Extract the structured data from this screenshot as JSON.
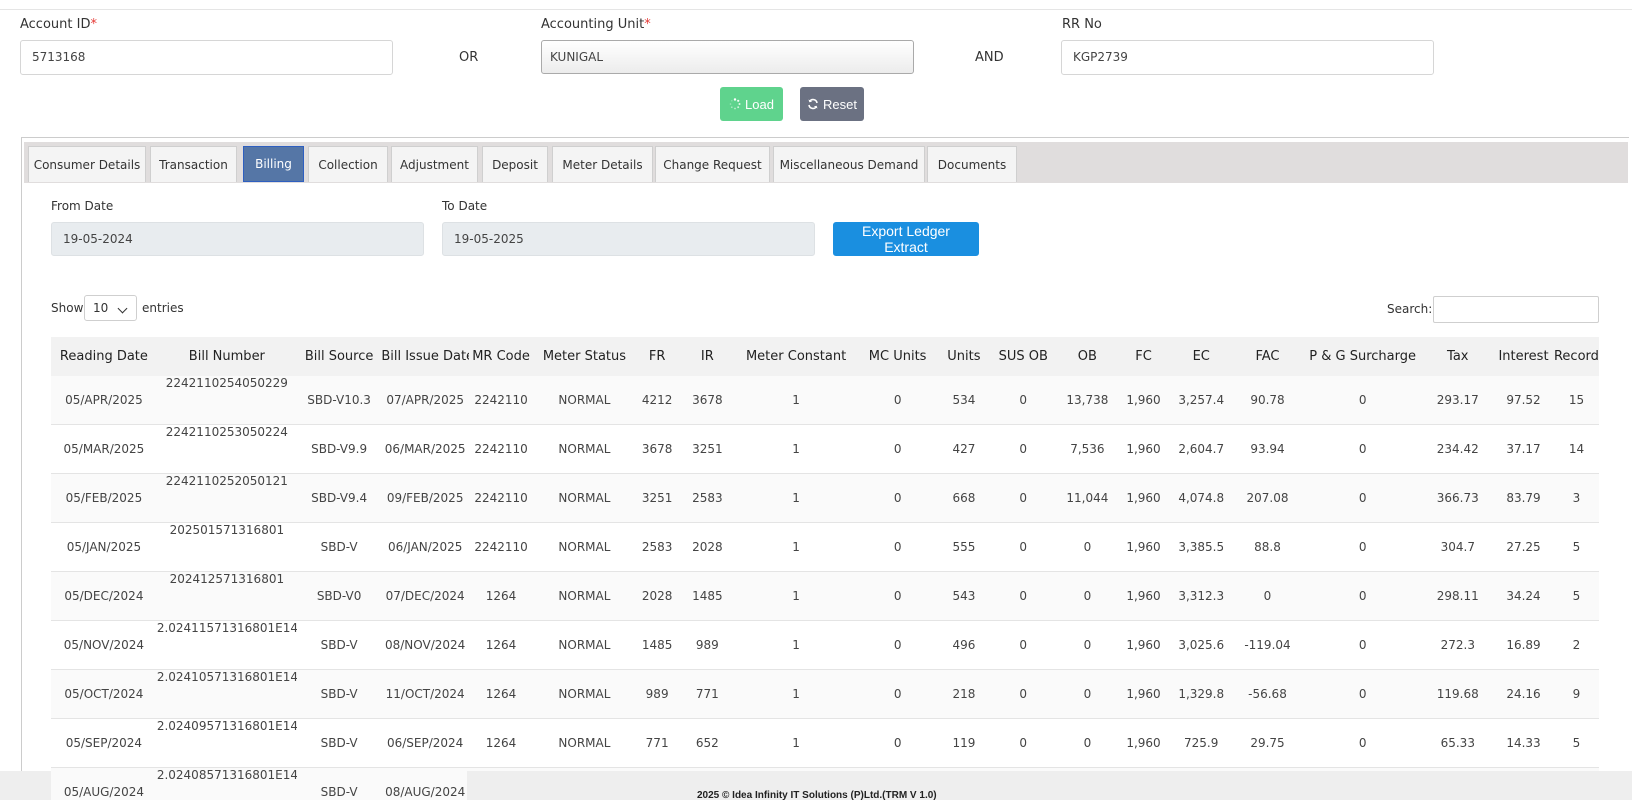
{
  "form": {
    "account_id": {
      "label": "Account ID",
      "required_mark": "*",
      "value": "5713168"
    },
    "or_text": "OR",
    "accounting_unit": {
      "label": "Accounting Unit",
      "required_mark": "*",
      "value": "KUNIGAL"
    },
    "and_text": "AND",
    "rr_no": {
      "label": "RR No",
      "value": "KGP2739"
    },
    "load_label": "Load",
    "reset_label": "Reset"
  },
  "tabs": [
    {
      "label": "Consumer Details",
      "active": false
    },
    {
      "label": "Transaction",
      "active": false
    },
    {
      "label": "Billing",
      "active": true
    },
    {
      "label": "Collection",
      "active": false
    },
    {
      "label": "Adjustment",
      "active": false
    },
    {
      "label": "Deposit",
      "active": false
    },
    {
      "label": "Meter Details",
      "active": false
    },
    {
      "label": "Change Request",
      "active": false
    },
    {
      "label": "Miscellaneous Demand",
      "active": false
    },
    {
      "label": "Documents",
      "active": false
    }
  ],
  "billing": {
    "from_date": {
      "label": "From Date",
      "value": "19-05-2024"
    },
    "to_date": {
      "label": "To Date",
      "value": "19-05-2025"
    },
    "export_label": "Export Ledger Extract",
    "show_label": "Show",
    "entries_value": "10",
    "entries_label": "entries",
    "search_label": "Search:",
    "search_value": ""
  },
  "table": {
    "columns": [
      "Reading Date",
      "Bill Number",
      "Bill Source",
      "Bill Issue Date",
      "MR Code",
      "Meter Status",
      "FR",
      "IR",
      "Meter Constant",
      "MC Units",
      "Units",
      "SUS OB",
      "OB",
      "FC",
      "EC",
      "FAC",
      "P & G Surcharge",
      "Tax",
      "Interest",
      "Recorded BMD"
    ],
    "rows": [
      [
        "05/APR/2025",
        "2242110254050229",
        "SBD-V10.3",
        "07/APR/2025",
        "2242110",
        "NORMAL",
        "4212",
        "3678",
        "1",
        "0",
        "534",
        "0",
        "13,738",
        "1,960",
        "3,257.4",
        "90.78",
        "0",
        "293.17",
        "97.52",
        "15"
      ],
      [
        "05/MAR/2025",
        "2242110253050224",
        "SBD-V9.9",
        "06/MAR/2025",
        "2242110",
        "NORMAL",
        "3678",
        "3251",
        "1",
        "0",
        "427",
        "0",
        "7,536",
        "1,960",
        "2,604.7",
        "93.94",
        "0",
        "234.42",
        "37.17",
        "14"
      ],
      [
        "05/FEB/2025",
        "2242110252050121",
        "SBD-V9.4",
        "09/FEB/2025",
        "2242110",
        "NORMAL",
        "3251",
        "2583",
        "1",
        "0",
        "668",
        "0",
        "11,044",
        "1,960",
        "4,074.8",
        "207.08",
        "0",
        "366.73",
        "83.79",
        "3"
      ],
      [
        "05/JAN/2025",
        "202501571316801",
        "SBD-V",
        "06/JAN/2025",
        "2242110",
        "NORMAL",
        "2583",
        "2028",
        "1",
        "0",
        "555",
        "0",
        "0",
        "1,960",
        "3,385.5",
        "88.8",
        "0",
        "304.7",
        "27.25",
        "5"
      ],
      [
        "05/DEC/2024",
        "202412571316801",
        "SBD-V0",
        "07/DEC/2024",
        "1264",
        "NORMAL",
        "2028",
        "1485",
        "1",
        "0",
        "543",
        "0",
        "0",
        "1,960",
        "3,312.3",
        "0",
        "0",
        "298.11",
        "34.24",
        "5"
      ],
      [
        "05/NOV/2024",
        "2.02411571316801E14",
        "SBD-V",
        "08/NOV/2024",
        "1264",
        "NORMAL",
        "1485",
        "989",
        "1",
        "0",
        "496",
        "0",
        "0",
        "1,960",
        "3,025.6",
        "-119.04",
        "0",
        "272.3",
        "16.89",
        "2"
      ],
      [
        "05/OCT/2024",
        "2.02410571316801E14",
        "SBD-V",
        "11/OCT/2024",
        "1264",
        "NORMAL",
        "989",
        "771",
        "1",
        "0",
        "218",
        "0",
        "0",
        "1,960",
        "1,329.8",
        "-56.68",
        "0",
        "119.68",
        "24.16",
        "9"
      ],
      [
        "05/SEP/2024",
        "2.02409571316801E14",
        "SBD-V",
        "06/SEP/2024",
        "1264",
        "NORMAL",
        "771",
        "652",
        "1",
        "0",
        "119",
        "0",
        "0",
        "1,960",
        "725.9",
        "29.75",
        "0",
        "65.33",
        "14.33",
        "5"
      ],
      [
        "05/AUG/2024",
        "2.02408571316801E14",
        "SBD-V",
        "08/AUG/2024",
        "",
        "",
        "",
        "",
        "",
        "",
        "",
        "",
        "",
        "",
        "",
        "",
        "",
        "",
        "",
        ""
      ]
    ]
  },
  "footer": {
    "text": "2025 © Idea Infinity IT Solutions (P)Ltd.(TRM V 1.0)"
  },
  "colors": {
    "load": "#5fd38d",
    "reset": "#6b7182",
    "export": "#1a8fe0",
    "active_tab": "#5576a6",
    "required": "#e53935"
  },
  "icons": {
    "load": "spinner-icon",
    "reset": "refresh-icon",
    "entries": "chevron-down-icon"
  }
}
